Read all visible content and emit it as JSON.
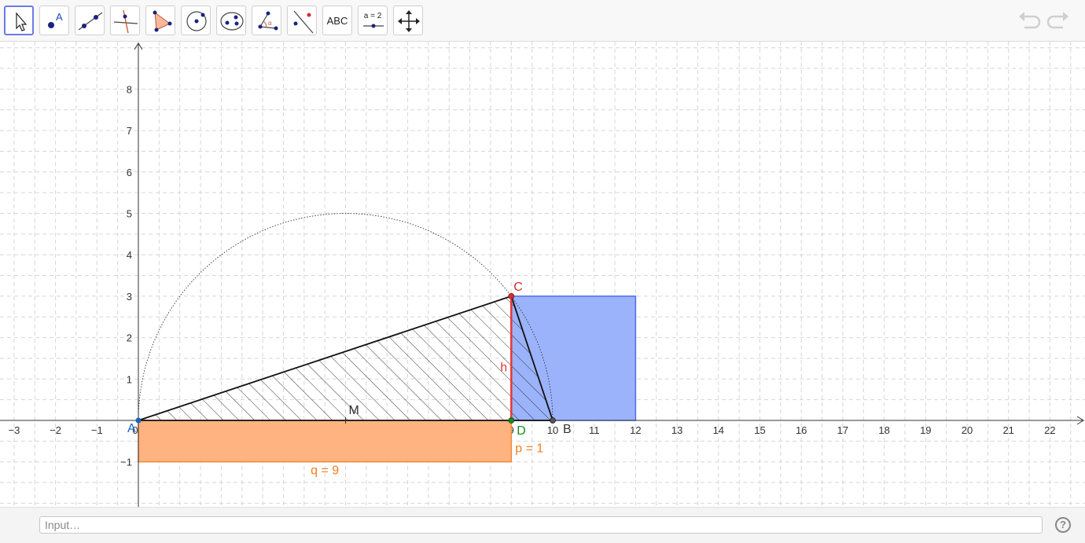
{
  "toolbar": {
    "tools": [
      {
        "name": "move-tool",
        "icon": "pointer-icon"
      },
      {
        "name": "point-tool",
        "icon": "point-icon",
        "label": "A"
      },
      {
        "name": "line-tool",
        "icon": "line-icon"
      },
      {
        "name": "perpendicular-line-tool",
        "icon": "perpendicular-icon"
      },
      {
        "name": "polygon-tool",
        "icon": "polygon-icon"
      },
      {
        "name": "circle-center-point-tool",
        "icon": "circle-icon"
      },
      {
        "name": "ellipse-tool",
        "icon": "ellipse-icon"
      },
      {
        "name": "angle-tool",
        "icon": "angle-icon",
        "label": "α"
      },
      {
        "name": "reflect-tool",
        "icon": "reflect-icon"
      },
      {
        "name": "text-tool",
        "icon": "text-icon",
        "label": "ABC"
      },
      {
        "name": "slider-tool",
        "icon": "slider-icon",
        "label": "a = 2"
      },
      {
        "name": "move-graphics-view-tool",
        "icon": "move-graphics-icon"
      }
    ],
    "undo_icon": "undo-icon",
    "redo_icon": "redo-icon"
  },
  "graphics": {
    "x_ticks": [
      "−3",
      "−2",
      "−1",
      "0",
      "1",
      "2",
      "3",
      "4",
      "5",
      "6",
      "7",
      "8",
      "9",
      "10",
      "11",
      "12",
      "13",
      "14",
      "15",
      "16",
      "17",
      "18",
      "19",
      "20",
      "21",
      "22"
    ],
    "y_ticks": [
      "−1",
      "1",
      "2",
      "3",
      "4",
      "5",
      "6",
      "7",
      "8"
    ],
    "points": {
      "A": {
        "label": "A",
        "x": 0,
        "y": 0,
        "color": "#1565c0"
      },
      "B": {
        "label": "B",
        "x": 10,
        "y": 0,
        "color": "#333333"
      },
      "C": {
        "label": "C",
        "x": 9,
        "y": 3,
        "color": "#d32f2f"
      },
      "D": {
        "label": "D",
        "x": 9,
        "y": 0,
        "color": "#1b8a1b"
      },
      "M": {
        "label": "M",
        "x": 5,
        "y": 0,
        "color": "#333333"
      }
    },
    "height_label": "h",
    "p_label": "p = 1",
    "q_label": "q = 9",
    "colors": {
      "height": "#e53935",
      "orange_fill": "#ffb380",
      "orange_stroke": "#f28b3a",
      "orange_text": "#f57c1f",
      "blue_fill": "#9bb3fa",
      "blue_stroke": "#4c6ef0"
    }
  },
  "inputbar": {
    "placeholder": "Input…",
    "help_icon": "?"
  }
}
